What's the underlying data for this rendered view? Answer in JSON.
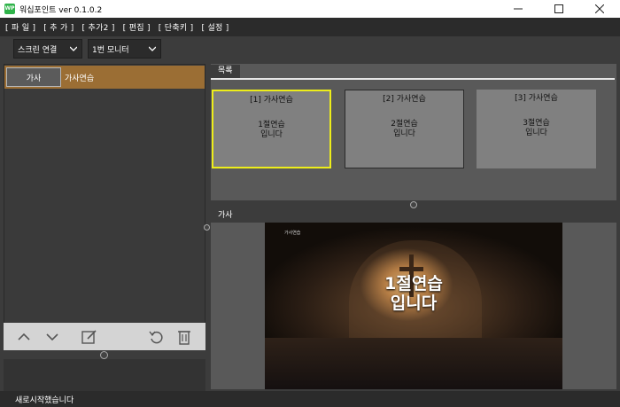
{
  "window": {
    "app_icon_text": "WP",
    "title": "워십포인트 ver 0.1.0.2"
  },
  "menu": [
    "[ 파 일 ]",
    "[ 추 가 ]",
    "[ 추가2 ]",
    "[ 편집 ]",
    "[ 단축키 ]",
    "[ 설정 ]"
  ],
  "toolbar": {
    "screen_select": "스크린 연결",
    "monitor_select": "1번 모니터"
  },
  "song_list": [
    {
      "tag": "가사",
      "title": "가사연습",
      "selected": true
    }
  ],
  "panels": {
    "list_tab": "목록",
    "lyrics_tab": "가사"
  },
  "slides": [
    {
      "head": "[1] 가사연습",
      "line1": "1절연습",
      "line2": "입니다",
      "active": true
    },
    {
      "head": "[2] 가사연습",
      "line1": "2절연습",
      "line2": "입니다",
      "active": false
    },
    {
      "head": "[3] 가사연습",
      "line1": "3절연습",
      "line2": "입니다",
      "active": false
    }
  ],
  "preview": {
    "small_title": "가사연습",
    "line1": "1절연습",
    "line2": "입니다"
  },
  "status": "새로시작했습니다",
  "colors": {
    "selected_row": "#9b6e34",
    "active_slide_border": "#eded1a",
    "slide_bg": "#808080"
  },
  "icons": [
    "up-arrow-icon",
    "down-arrow-icon",
    "edit-icon",
    "undo-icon",
    "trash-icon",
    "minimize-icon",
    "maximize-icon",
    "close-icon",
    "caret-down-icon"
  ]
}
